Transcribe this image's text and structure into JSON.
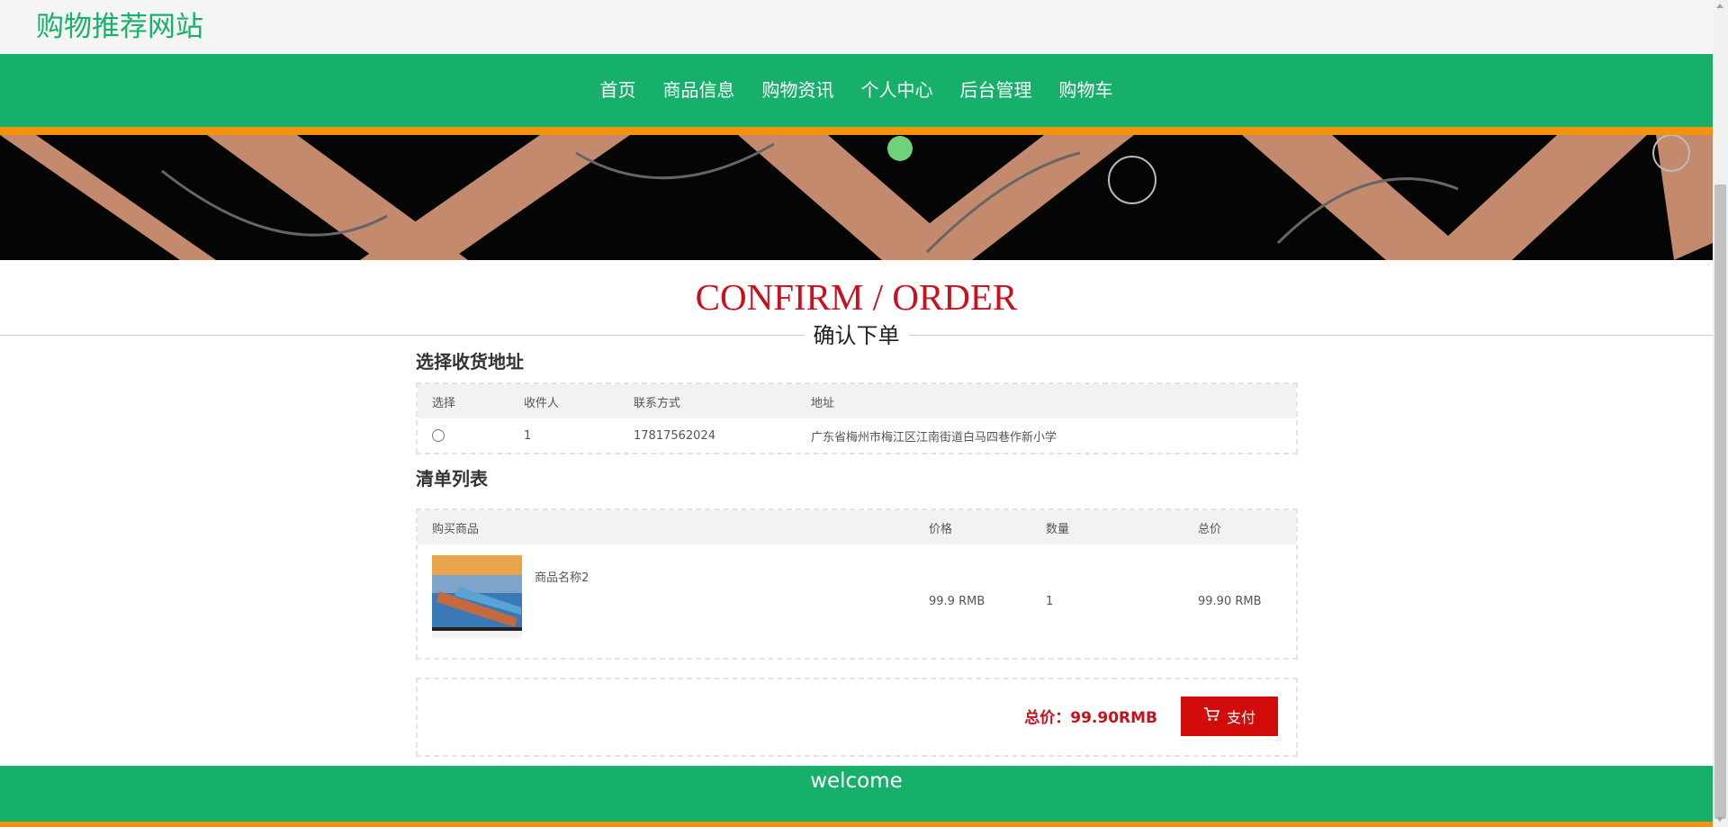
{
  "site": {
    "title": "购物推荐网站"
  },
  "nav": {
    "items": [
      {
        "label": "首页"
      },
      {
        "label": "商品信息"
      },
      {
        "label": "购物资讯"
      },
      {
        "label": "个人中心"
      },
      {
        "label": "后台管理"
      },
      {
        "label": "购物车"
      }
    ]
  },
  "page": {
    "title_en": "CONFIRM / ORDER",
    "title_cn": "确认下单"
  },
  "address": {
    "heading": "选择收货地址",
    "columns": [
      "选择",
      "收件人",
      "联系方式",
      "地址"
    ],
    "rows": [
      {
        "recipient": "1",
        "phone": "17817562024",
        "address": "广东省梅州市梅江区江南街道白马四巷作新小学"
      }
    ]
  },
  "cart": {
    "heading": "清单列表",
    "columns": [
      "购买商品",
      "价格",
      "数量",
      "总价"
    ],
    "rows": [
      {
        "name": "商品名称2",
        "price": "99.9 RMB",
        "qty": "1",
        "total": "99.90 RMB"
      }
    ]
  },
  "summary": {
    "total_label": "总价：99.90RMB",
    "pay_label": "支付"
  },
  "footer": {
    "text": "welcome"
  },
  "colors": {
    "brand_green": "#17b06a",
    "accent_orange": "#f5930f",
    "accent_red": "#c9111e",
    "button_red": "#d20b0b"
  }
}
